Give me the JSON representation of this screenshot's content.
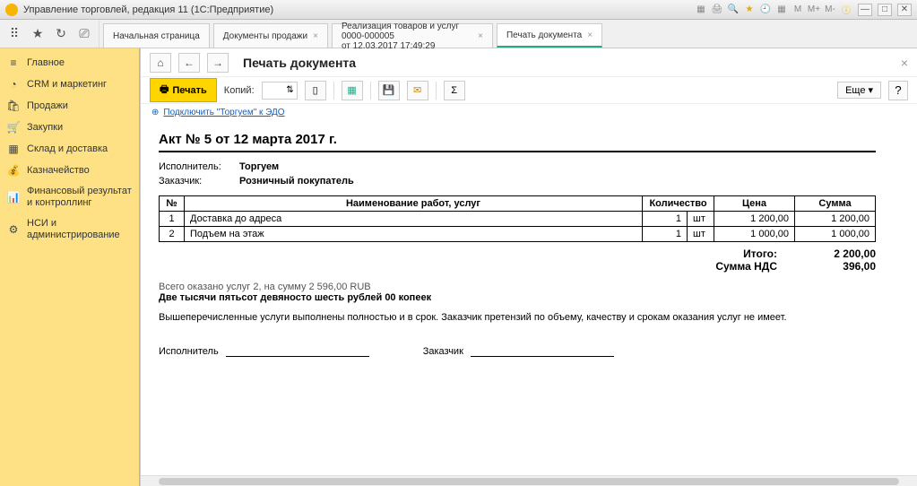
{
  "title": "Управление торговлей, редакция 11  (1С:Предприятие)",
  "tabs": [
    {
      "label": "Начальная страница"
    },
    {
      "label": "Документы продажи"
    },
    {
      "label": "Реализация товаров и услуг 0000-000005\nот 12.03.2017 17:49:29"
    },
    {
      "label": "Печать документа"
    }
  ],
  "sidebar": [
    {
      "icon": "≡",
      "label": "Главное"
    },
    {
      "icon": "◔",
      "label": "CRM и маркетинг"
    },
    {
      "icon": "🛍",
      "label": "Продажи"
    },
    {
      "icon": "🛒",
      "label": "Закупки"
    },
    {
      "icon": "▦",
      "label": "Склад и доставка"
    },
    {
      "icon": "💰",
      "label": "Казначейство"
    },
    {
      "icon": "📊",
      "label": "Финансовый результат и контроллинг"
    },
    {
      "icon": "⚙",
      "label": "НСИ и администрирование"
    }
  ],
  "page_title": "Печать документа",
  "toolbar": {
    "print": "Печать",
    "copies_label": "Копий:",
    "copies_value": "",
    "more": "Еще",
    "help": "?"
  },
  "edo_link": "Подключить \"Торгуем\" к ЭДО",
  "doc": {
    "heading": "Акт № 5 от 12 марта 2017 г.",
    "performer_label": "Исполнитель:",
    "performer": "Торгуем",
    "customer_label": "Заказчик:",
    "customer": "Розничный покупатель",
    "th": {
      "n": "№",
      "name": "Наименование работ, услуг",
      "qty": "Количество",
      "price": "Цена",
      "sum": "Сумма"
    },
    "rows": [
      {
        "n": "1",
        "name": "Доставка до адреса",
        "qty": "1",
        "unit": "шт",
        "price": "1 200,00",
        "sum": "1 200,00"
      },
      {
        "n": "2",
        "name": "Подъем на этаж",
        "qty": "1",
        "unit": "шт",
        "price": "1 000,00",
        "sum": "1 000,00"
      }
    ],
    "total_label": "Итого:",
    "total": "2 200,00",
    "vat_label": "Сумма НДС",
    "vat": "396,00",
    "summary_line": "Всего оказано услуг 2, на сумму 2 596,00 RUB",
    "words": "Две тысячи пятьсот девяносто шесть рублей 00 копеек",
    "note": "Вышеперечисленные услуги выполнены полностью и в срок. Заказчик претензий по объему, качеству и срокам оказания услуг не имеет.",
    "sig_performer": "Исполнитель",
    "sig_customer": "Заказчик"
  }
}
